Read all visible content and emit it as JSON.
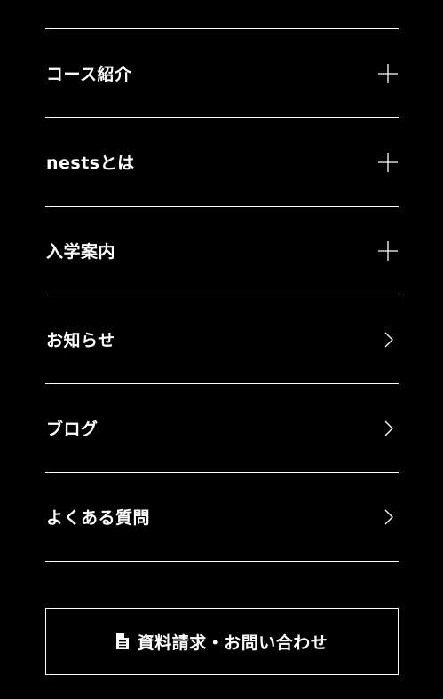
{
  "menu": {
    "items": [
      {
        "label": "コース紹介",
        "icon": "plus-icon"
      },
      {
        "label": "nestsとは",
        "icon": "plus-icon"
      },
      {
        "label": "入学案内",
        "icon": "plus-icon"
      },
      {
        "label": "お知らせ",
        "icon": "chevron-right-icon"
      },
      {
        "label": "ブログ",
        "icon": "chevron-right-icon"
      },
      {
        "label": "よくある質問",
        "icon": "chevron-right-icon"
      }
    ]
  },
  "cta": {
    "label": "資料請求・お問い合わせ",
    "icon": "document-icon"
  },
  "colors": {
    "background": "#000000",
    "foreground": "#ffffff"
  }
}
